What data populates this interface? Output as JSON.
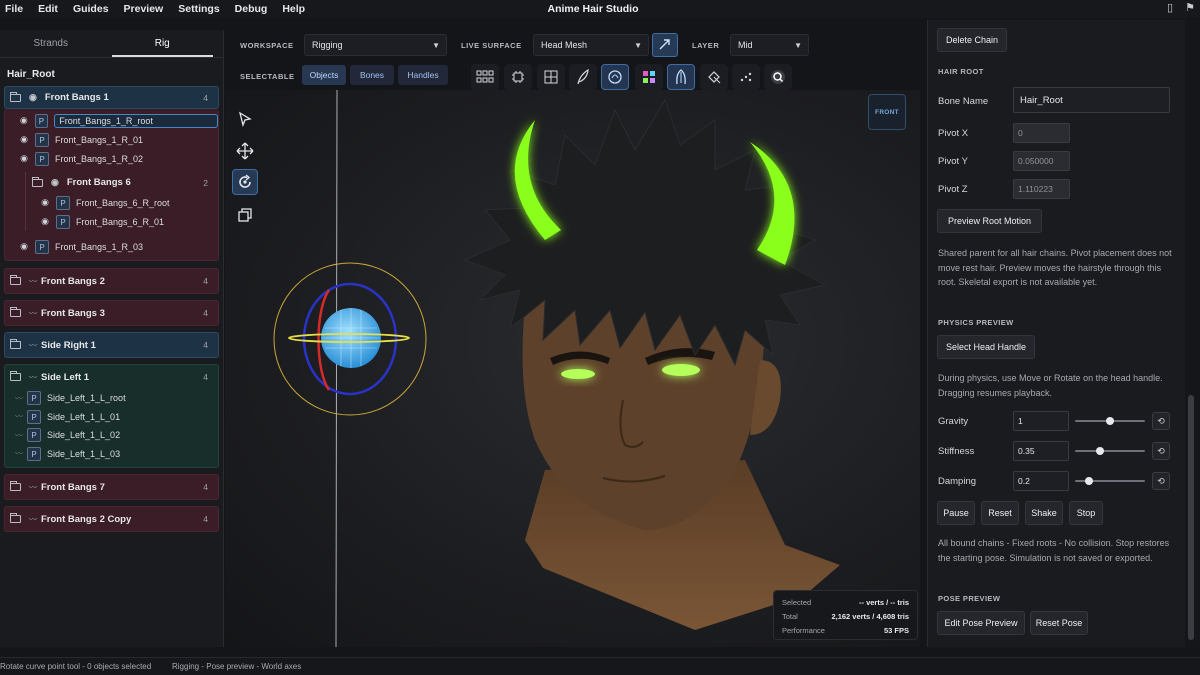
{
  "menubar": {
    "items": [
      "File",
      "Edit",
      "Guides",
      "Preview",
      "Settings",
      "Debug",
      "Help"
    ],
    "title": "Anime Hair Studio"
  },
  "left_panel": {
    "tabs": [
      {
        "label": "Strands",
        "active": false
      },
      {
        "label": "Rig",
        "active": true
      }
    ],
    "root_label": "Hair_Root",
    "front_bangs_1": {
      "label": "Front Bangs 1",
      "count": "4",
      "rows": [
        "Front_Bangs_1_R_root",
        "Front_Bangs_1_R_01",
        "Front_Bangs_1_R_02"
      ],
      "subgroup": {
        "label": "Front Bangs 6",
        "count": "2",
        "rows": [
          "Front_Bangs_6_R_root",
          "Front_Bangs_6_R_01"
        ]
      },
      "last_row": "Front_Bangs_1_R_03"
    },
    "front_bangs_2": {
      "label": "Front Bangs 2",
      "count": "4"
    },
    "front_bangs_3": {
      "label": "Front Bangs 3",
      "count": "4"
    },
    "side_right_1": {
      "label": "Side Right 1",
      "count": "4"
    },
    "side_left_1": {
      "label": "Side Left 1",
      "count": "4",
      "rows": [
        "Side_Left_1_L_root",
        "Side_Left_1_L_01",
        "Side_Left_1_L_02",
        "Side_Left_1_L_03"
      ]
    },
    "front_bangs_7": {
      "label": "Front Bangs 7",
      "count": "4"
    },
    "front_bangs_2_copy": {
      "label": "Front Bangs 2 Copy",
      "count": "4"
    },
    "p_glyph": "P"
  },
  "toolbar": {
    "workspace_label": "WORKSPACE",
    "workspace_value": "Rigging",
    "live_surface_label": "LIVE SURFACE",
    "live_surface_value": "Head Mesh",
    "layer_label": "LAYER",
    "layer_value": "Mid",
    "selectable_label": "SELECTABLE",
    "selectable_buttons": [
      "Objects",
      "Bones",
      "Handles"
    ]
  },
  "viewport": {
    "front_badge": "FRONT",
    "stats": {
      "selected_label": "Selected",
      "selected_value": "-- verts / -- tris",
      "total_label": "Total",
      "total_value": "2,162 verts / 4,608 tris",
      "performance_label": "Performance",
      "performance_value": "53 FPS"
    }
  },
  "right_panel": {
    "delete_chain": "Delete Chain",
    "hair_root_section": "HAIR ROOT",
    "bone_name_label": "Bone Name",
    "bone_name_value": "Hair_Root",
    "pivot_x_label": "Pivot X",
    "pivot_x_value": "0",
    "pivot_y_label": "Pivot Y",
    "pivot_y_value": "0.050000",
    "pivot_z_label": "Pivot Z",
    "pivot_z_value": "1.110223",
    "preview_root_motion": "Preview Root Motion",
    "root_help": "Shared parent for all hair chains. Pivot placement does not move rest hair. Preview moves the hairstyle through this root. Skeletal export is not available yet.",
    "physics_section": "PHYSICS PREVIEW",
    "select_head_handle": "Select Head Handle",
    "physics_help": "During physics, use Move or Rotate on the head handle. Dragging resumes playback.",
    "gravity_label": "Gravity",
    "gravity_value": "1",
    "gravity_level": 0.5,
    "stiffness_label": "Stiffness",
    "stiffness_value": "0.35",
    "stiffness_level": 0.35,
    "damping_label": "Damping",
    "damping_value": "0.2",
    "damping_level": 0.2,
    "reset_glyph": "⟲",
    "physics_buttons": [
      "Pause",
      "Reset",
      "Shake",
      "Stop"
    ],
    "physics_note": "All bound chains - Fixed roots - No collision. Stop restores the starting pose. Simulation is not saved or exported.",
    "pose_section": "POSE PREVIEW",
    "edit_pose_preview": "Edit Pose Preview",
    "reset_pose": "Reset Pose"
  },
  "statusbar": {
    "left": "Rotate curve point tool - 0 objects selected",
    "mid": "Rigging - Pose preview - World axes"
  },
  "colors": {
    "accent": "#4a86c6",
    "horn_glow": "#9cff2e",
    "skin": "#6b4a2e",
    "hair": "#1b1c1e"
  },
  "icons": {
    "window": [
      "window-icon",
      "record-icon"
    ],
    "vertical_tools": [
      "select-arrow-icon",
      "move-icon",
      "rotate-icon",
      "duplicate-icon"
    ],
    "top_tools": [
      "grid-icon",
      "frame-icon",
      "transform-icon",
      "feather-icon",
      "head-icon",
      "color-grid-icon",
      "hair-strand-icon",
      "paint-icon",
      "points-icon",
      "search-icon"
    ]
  }
}
